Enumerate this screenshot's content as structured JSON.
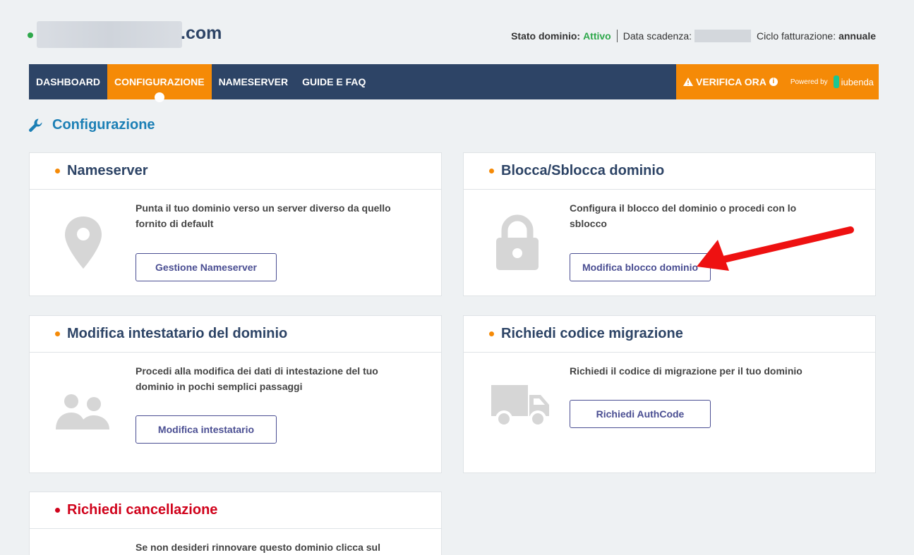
{
  "header": {
    "domain_tld": ".com",
    "stato_label": "Stato dominio:",
    "stato_value": "Attivo",
    "scadenza_label": "Data scadenza:",
    "ciclo_label": "Ciclo fatturazione:",
    "ciclo_value": "annuale"
  },
  "nav": {
    "items": [
      {
        "label": "DASHBOARD"
      },
      {
        "label": "CONFIGURAZIONE",
        "active": true
      },
      {
        "label": "NAMESERVER"
      },
      {
        "label": "GUIDE E FAQ"
      }
    ],
    "verify_label": "VERIFICA ORA",
    "powered_by": "Powered by",
    "iubenda": "iubenda"
  },
  "page_title": "Configurazione",
  "cards": [
    {
      "title": "Nameserver",
      "icon": "map-pin-icon",
      "desc": "Punta il tuo dominio verso un server diverso da quello fornito di default",
      "button": "Gestione Nameserver"
    },
    {
      "title": "Blocca/Sblocca dominio",
      "icon": "lock-icon",
      "desc": "Configura il blocco del dominio o procedi con lo sblocco",
      "button": "Modifica blocco dominio"
    },
    {
      "title": "Modifica intestatario del dominio",
      "icon": "users-icon",
      "desc": "Procedi alla modifica dei dati di intestazione del tuo dominio in pochi semplici passaggi",
      "button": "Modifica intestatario"
    },
    {
      "title": "Richiedi codice migrazione",
      "icon": "truck-icon",
      "desc": "Richiedi il codice di migrazione per il tuo dominio",
      "button": "Richiedi AuthCode"
    },
    {
      "title": "Richiedi cancellazione",
      "icon": "trash-icon",
      "desc": "Se non desideri rinnovare questo dominio clicca sul"
    }
  ],
  "colors": {
    "navy": "#2d4466",
    "orange": "#f58a07",
    "green": "#2ea84b",
    "red": "#d0021b",
    "link_blue": "#1b7fb5"
  }
}
